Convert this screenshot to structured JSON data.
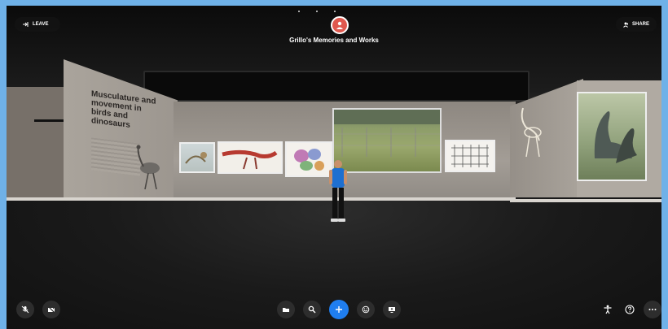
{
  "header": {
    "leave_label": "LEAVE",
    "share_label": "SHARE",
    "room_title": "Grillo's Memories and Works"
  },
  "gallery": {
    "wall_title": "Musculature and movement in birds and dinosaurs"
  },
  "toolbar": {
    "left": [
      "mic-off-icon",
      "camera-off-icon"
    ],
    "center": [
      "folder-icon",
      "search-icon",
      "add-icon",
      "emoji-icon",
      "screen-share-icon"
    ],
    "right": [
      "accessibility-icon",
      "help-icon",
      "more-icon"
    ]
  },
  "colors": {
    "accent": "#1f7ef0",
    "avatar_shirt": "#1e6fd0",
    "outer_border": "#6fb1e8"
  }
}
